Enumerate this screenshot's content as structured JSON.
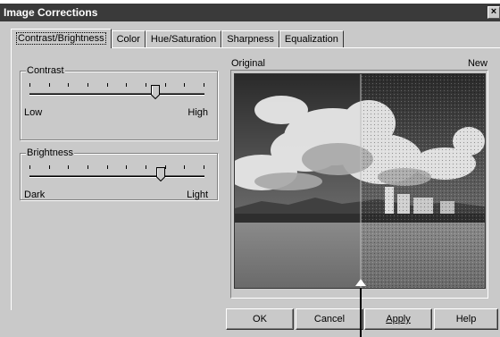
{
  "window": {
    "title": "Image Corrections",
    "close_glyph": "×"
  },
  "tabs": [
    {
      "label": "Contrast/Brightness",
      "active": true
    },
    {
      "label": "Color"
    },
    {
      "label": "Hue/Saturation"
    },
    {
      "label": "Sharpness"
    },
    {
      "label": "Equalization"
    }
  ],
  "contrast": {
    "title": "Contrast",
    "low_label": "Low",
    "high_label": "High",
    "value": 0.72
  },
  "brightness": {
    "title": "Brightness",
    "low_label": "Dark",
    "high_label": "Light",
    "value": 0.75
  },
  "preview": {
    "original_label": "Original",
    "new_label": "New"
  },
  "buttons": {
    "ok": "OK",
    "cancel": "Cancel",
    "apply": "Apply",
    "help": "Help"
  },
  "colors": {
    "title_bar": "#3a3a3a",
    "dialog_face": "#c9c9c9"
  }
}
